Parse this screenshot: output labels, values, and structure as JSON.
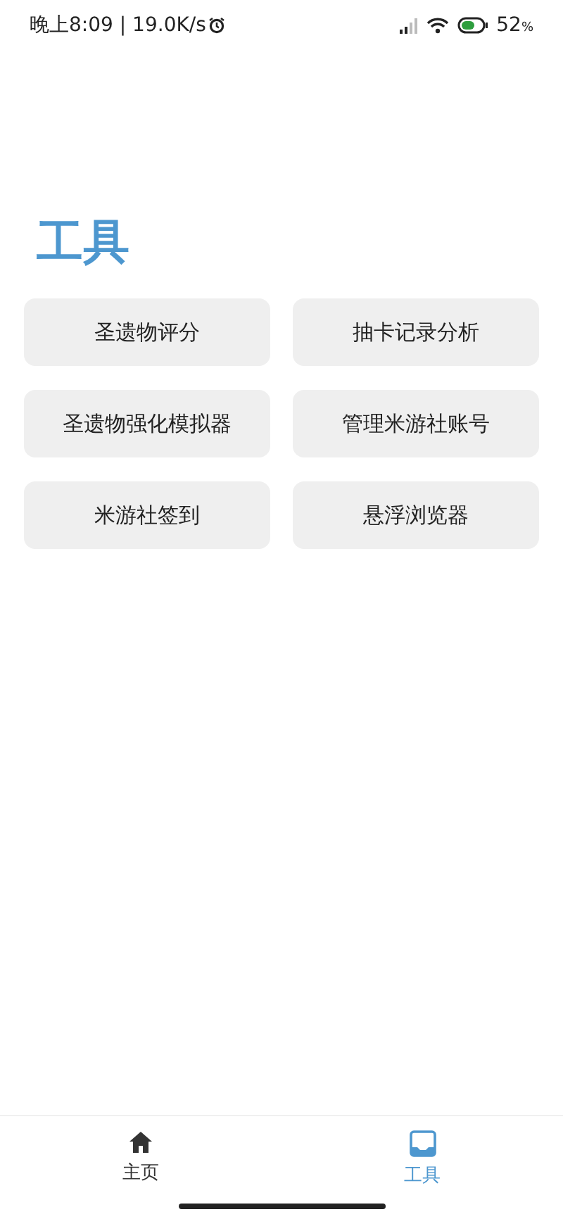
{
  "status_bar": {
    "time": "晚上8:09 | 19.0K/s",
    "battery": "52",
    "battery_unit": "%"
  },
  "title": "工具",
  "tools": [
    {
      "label": "圣遗物评分"
    },
    {
      "label": "抽卡记录分析"
    },
    {
      "label": "圣遗物强化模拟器"
    },
    {
      "label": "管理米游社账号"
    },
    {
      "label": "米游社签到"
    },
    {
      "label": "悬浮浏览器"
    }
  ],
  "nav": [
    {
      "label": "主页",
      "kind": "home",
      "selected": false
    },
    {
      "label": "工具",
      "kind": "tools",
      "selected": true
    }
  ]
}
